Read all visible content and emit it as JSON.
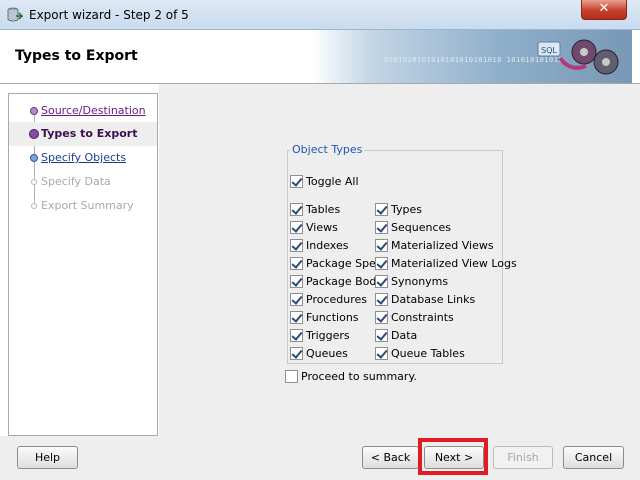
{
  "window": {
    "title": "Export wizard - Step 2 of 5",
    "close_label": "✕"
  },
  "header": {
    "title": "Types to Export",
    "art_text": "0101010101010101010101010 101010101010"
  },
  "nav": {
    "items": [
      {
        "label": "Source/Destination",
        "state": "visited"
      },
      {
        "label": "Types to Export",
        "state": "current"
      },
      {
        "label": "Specify Objects",
        "state": "link"
      },
      {
        "label": "Specify Data",
        "state": "disabled"
      },
      {
        "label": "Export Summary",
        "state": "disabled"
      }
    ]
  },
  "object_types": {
    "title": "Object Types",
    "toggle_all": {
      "label": "Toggle All",
      "checked": true
    },
    "left_column": [
      {
        "label": "Tables",
        "checked": true
      },
      {
        "label": "Views",
        "checked": true
      },
      {
        "label": "Indexes",
        "checked": true
      },
      {
        "label": "Package Spec",
        "checked": true
      },
      {
        "label": "Package Body",
        "checked": true
      },
      {
        "label": "Procedures",
        "checked": true
      },
      {
        "label": "Functions",
        "checked": true
      },
      {
        "label": "Triggers",
        "checked": true
      },
      {
        "label": "Queues",
        "checked": true
      }
    ],
    "right_column": [
      {
        "label": "Types",
        "checked": true
      },
      {
        "label": "Sequences",
        "checked": true
      },
      {
        "label": "Materialized Views",
        "checked": true
      },
      {
        "label": "Materialized View Logs",
        "checked": true
      },
      {
        "label": "Synonyms",
        "checked": true
      },
      {
        "label": "Database Links",
        "checked": true
      },
      {
        "label": "Constraints",
        "checked": true
      },
      {
        "label": "Data",
        "checked": true
      },
      {
        "label": "Queue Tables",
        "checked": true
      }
    ]
  },
  "proceed": {
    "label": "Proceed to summary.",
    "checked": false
  },
  "buttons": {
    "help": "Help",
    "back": "< Back",
    "next": "Next >",
    "finish": "Finish",
    "cancel": "Cancel"
  },
  "colors": {
    "highlight": "#e01b24",
    "link": "#1a3d96",
    "visited": "#6a1b8a",
    "group_title": "#1f55b3"
  }
}
